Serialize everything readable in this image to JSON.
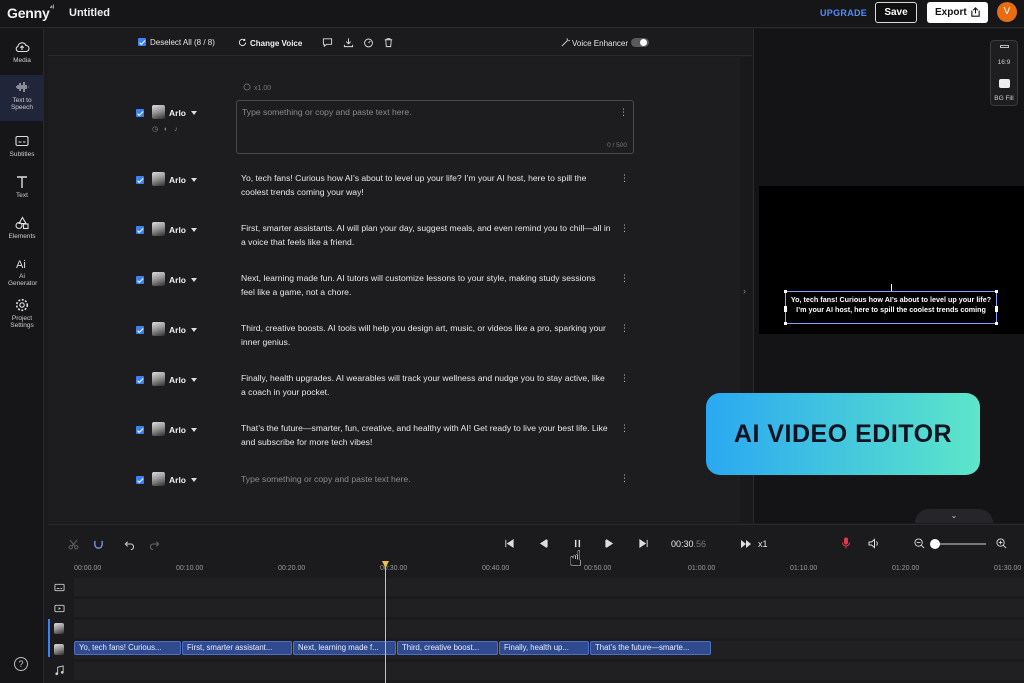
{
  "header": {
    "logo": "Genny",
    "logo_mark": "⁴ᴵ",
    "doc_title": "Untitled",
    "upgrade": "UPGRADE",
    "save": "Save",
    "export": "Export",
    "avatar_letter": "V"
  },
  "sidebar": {
    "items": [
      {
        "label": "Media",
        "icon": "cloud-upload-icon"
      },
      {
        "label": "Text to Speech",
        "icon": "waveform-icon"
      },
      {
        "label": "Subtitles",
        "icon": "subtitles-icon"
      },
      {
        "label": "Text",
        "icon": "text-t-icon"
      },
      {
        "label": "Elements",
        "icon": "shapes-icon"
      },
      {
        "label": "Ai Generator",
        "icon": "ai-icon"
      },
      {
        "label": "Project Settings",
        "icon": "gear-icon"
      }
    ],
    "help": "?"
  },
  "toolbar": {
    "deselect": "Deselect All (8 / 8)",
    "change_voice": "Change Voice",
    "voice_enhancer": "Voice Enhancer"
  },
  "script": {
    "speed": "x1.00",
    "char_count": "0 / 500",
    "voice": "Arlo",
    "rows": [
      {
        "text": "Type something or copy and paste text here.",
        "placeholder": true
      },
      {
        "text": "Yo, tech fans! Curious how AI’s about to level up your life? I’m your AI host, here to spill the coolest trends coming your way!"
      },
      {
        "text": "First, smarter assistants. AI will plan your day, suggest meals, and even remind you to chill—all in a voice that feels like a friend."
      },
      {
        "text": "Next, learning made fun. AI tutors will customize lessons to your style, making study sessions feel like a game, not a chore."
      },
      {
        "text": "Third, creative boosts. AI tools will help you design art, music, or videos like a pro, sparking your inner genius."
      },
      {
        "text": "Finally, health upgrades. AI wearables will track your wellness and nudge you to stay active, like a coach in your pocket."
      },
      {
        "text": "That’s the future—smarter, fun, creative, and healthy with AI! Get ready to live your best life. Like and subscribe for more tech vibes!"
      },
      {
        "text": "Type something or copy and paste text here.",
        "placeholder": true
      }
    ]
  },
  "preview": {
    "ratio": "16:9",
    "bg_fill": "BG Fill",
    "caption": "Yo, tech fans! Curious how AI’s about to level up your life? I’m your AI host, here to spill the coolest trends coming",
    "badge": "AI VIDEO EDITOR"
  },
  "timeline": {
    "current_time": "00:30",
    "current_frac": ".56",
    "speed": "x1",
    "ticks": [
      "00:00.00",
      "00:10.00",
      "00:20.00",
      "00:30.00",
      "00:40.00",
      "00:50.00",
      "01:00.00",
      "01:10.00",
      "01:20.00",
      "01:30.00"
    ],
    "clips": [
      "Yo, tech fans! Curious...",
      "First, smarter assistant...",
      "Next, learning made f...",
      "Third, creative boost...",
      "Finally, health up...",
      "That’s the future—smarte..."
    ]
  }
}
